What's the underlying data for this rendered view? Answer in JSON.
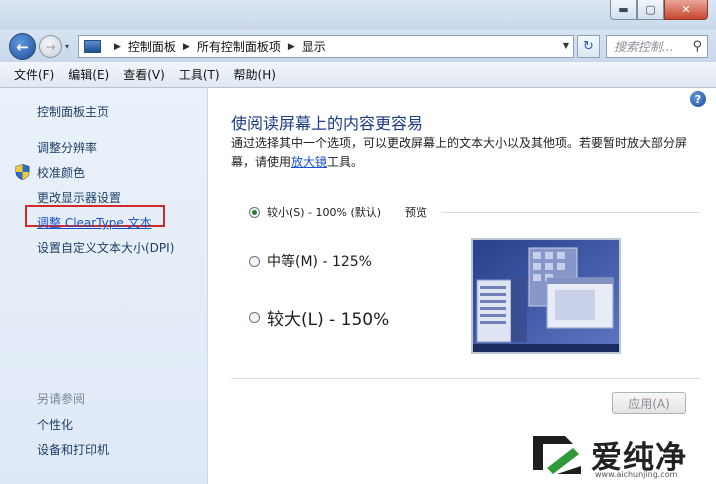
{
  "window": {
    "min_glyph": "▬",
    "max_glyph": "▢",
    "close_glyph": "✕"
  },
  "nav": {
    "back_glyph": "←",
    "forward_glyph": "→",
    "history_glyph": "▾",
    "breadcrumbs": [
      "控制面板",
      "所有控制面板项",
      "显示"
    ],
    "refresh_glyph": "↻",
    "search_placeholder": "搜索控制...",
    "search_glyph": "⚲"
  },
  "menubar": {
    "items": [
      "文件(F)",
      "编辑(E)",
      "查看(V)",
      "工具(T)",
      "帮助(H)"
    ]
  },
  "sidebar": {
    "items": [
      {
        "label": "控制面板主页"
      },
      {
        "label": "调整分辨率"
      },
      {
        "label": "校准颜色"
      },
      {
        "label": "更改显示器设置"
      },
      {
        "label": "调整 ClearType 文本"
      },
      {
        "label": "设置自定义文本大小(DPI)"
      }
    ],
    "see_also_label": "另请参阅",
    "see_also_items": [
      {
        "label": "个性化"
      },
      {
        "label": "设备和打印机"
      }
    ]
  },
  "main": {
    "help_glyph": "?",
    "title": "使阅读屏幕上的内容更容易",
    "desc_before": "通过选择其中一个选项，可以更改屏幕上的文本大小以及其他项。若要暂时放大部分屏幕，请使用",
    "desc_link": "放大镜",
    "desc_after": "工具。",
    "options": [
      {
        "label": "较小(S) - 100% (默认)",
        "checked": true
      },
      {
        "label": "中等(M) - 125%",
        "checked": false
      },
      {
        "label": "较大(L) - 150%",
        "checked": false
      }
    ],
    "preview_label": "预览",
    "apply_label": "应用(A)"
  },
  "watermark": {
    "text": "爱纯净",
    "url": "www.aichunjing.com"
  },
  "colors": {
    "link": "#1a4fcf",
    "title_blue": "#1e3b8a",
    "highlight_red": "#d32a2a"
  }
}
